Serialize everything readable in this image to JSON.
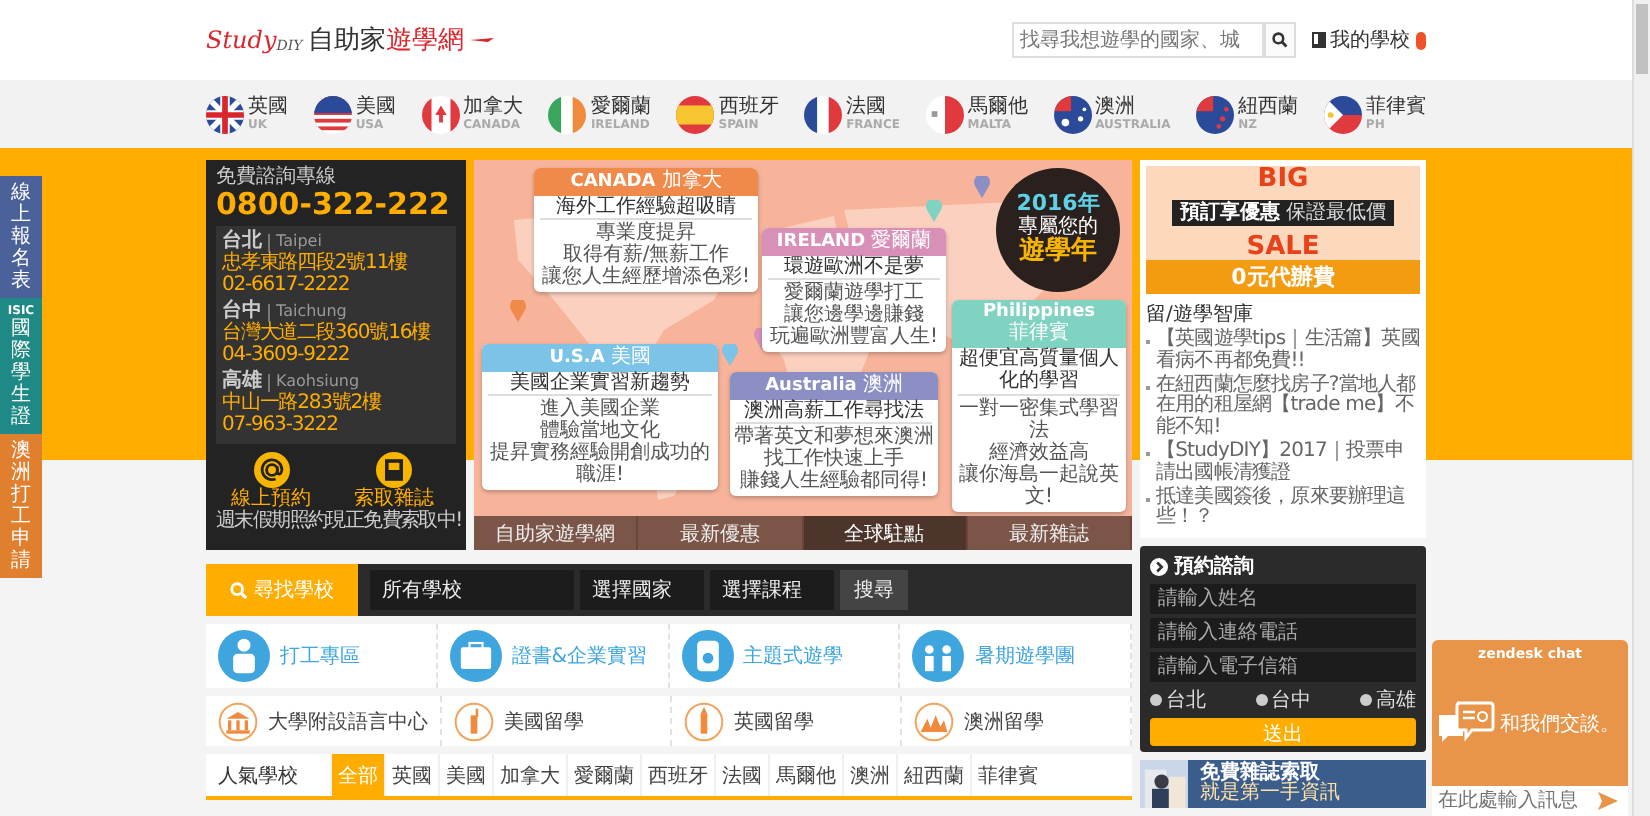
{
  "header": {
    "logo": {
      "latin": "Study",
      "latin_small": "DIY",
      "name": "自助家",
      "name_accent": "遊學網"
    },
    "search": {
      "placeholder": "找尋我想遊學的國家、城"
    },
    "my_school": "我的學校"
  },
  "countries": [
    {
      "name": "英國",
      "code": "UK",
      "kind": "uk"
    },
    {
      "name": "美國",
      "code": "USA",
      "kind": "usa"
    },
    {
      "name": "加拿大",
      "code": "CANADA",
      "kind": "canada"
    },
    {
      "name": "愛爾蘭",
      "code": "IRELAND",
      "kind": "ireland"
    },
    {
      "name": "西班牙",
      "code": "SPAIN",
      "kind": "spain"
    },
    {
      "name": "法國",
      "code": "FRANCE",
      "kind": "france"
    },
    {
      "name": "馬爾他",
      "code": "MALTA",
      "kind": "malta"
    },
    {
      "name": "澳洲",
      "code": "AUSTRALIA",
      "kind": "australia"
    },
    {
      "name": "紐西蘭",
      "code": "NZ",
      "kind": "nz"
    },
    {
      "name": "菲律賓",
      "code": "PH",
      "kind": "ph"
    }
  ],
  "side_tabs": [
    {
      "label": "線上報名表",
      "color": "#4a6199"
    },
    {
      "prefix": "ISIC",
      "label": "國際學生證",
      "color": "#1f8a85"
    },
    {
      "label": "澳洲打工申請",
      "color": "#e07f2e"
    }
  ],
  "contact": {
    "hotline_label": "免費諮詢專線",
    "hotline": "0800-322-222",
    "offices": [
      {
        "city": "台北",
        "city_en": "Taipei",
        "address": "忠孝東路四段2號11樓",
        "phone": "02-6617-2222"
      },
      {
        "city": "台中",
        "city_en": "Taichung",
        "address": "台灣大道二段360號16樓",
        "phone": "04-3609-9222"
      },
      {
        "city": "高雄",
        "city_en": "Kaohsiung",
        "address": "中山一路283號2樓",
        "phone": "07-963-3222"
      }
    ],
    "actions": [
      {
        "kind": "online",
        "label": "線上預約",
        "note": "週末假期照約"
      },
      {
        "kind": "magazine",
        "label": "索取雜誌",
        "note": "現正免費索取中!"
      }
    ]
  },
  "banner": {
    "badge": {
      "year": "2016年",
      "line": "專屬您的",
      "headline": "遊學年"
    },
    "callouts": [
      {
        "kind": "canada",
        "title": "CANADA",
        "title_local": "加拿大",
        "color": "#f08a4b",
        "headline": "海外工作經驗超吸睛",
        "lines": [
          "專業度提昇",
          "取得有薪/無薪工作",
          "讓您人生經歷增添色彩!"
        ]
      },
      {
        "kind": "ireland",
        "title": "IRELAND",
        "title_local": "愛爾蘭",
        "color": "#d88fb8",
        "headline": "環遊歐洲不是夢",
        "lines": [
          "愛爾蘭遊學打工",
          "讓您邊學邊賺錢",
          "玩遍歐洲豐富人生!"
        ]
      },
      {
        "kind": "usa",
        "title": "U.S.A",
        "title_local": "美國",
        "color": "#7cc3e8",
        "headline": "美國企業實習新趨勢",
        "lines": [
          "進入美國企業",
          "體驗當地文化",
          "提昇實務經驗開創成功的職涯!"
        ]
      },
      {
        "kind": "australia",
        "title": "Australia",
        "title_local": "澳洲",
        "color": "#8c8fc4",
        "headline": "澳洲高薪工作尋找法",
        "lines": [
          "帶著英文和夢想來澳洲",
          "找工作快速上手",
          "賺錢人生經驗都同得!"
        ]
      },
      {
        "kind": "philippines",
        "title": "Philippines",
        "title_local": "菲律賓",
        "color": "#7fd3c0",
        "headline": "超便宜高質量個人化的學習",
        "lines": [
          "一對一密集式學習法",
          "經濟效益高",
          "讓你海島一起說英文!"
        ]
      }
    ],
    "tabs": [
      {
        "label": "自助家遊學網",
        "selected": false
      },
      {
        "label": "最新優惠",
        "selected": false
      },
      {
        "label": "全球駐點",
        "selected": true
      },
      {
        "label": "最新雜誌",
        "selected": false
      }
    ]
  },
  "sidebar": {
    "promo": {
      "big": "BIG",
      "sale": "SALE",
      "ribbon": "預訂享優惠",
      "ribbon_sub": "保證最低價",
      "price": "0元代辦費"
    },
    "articles_title": "留/遊學智庫",
    "articles": [
      "【英國遊學tips｜生活篇】英國看病不再都免費!!",
      "在紐西蘭怎麼找房子?當地人都在用的租屋網【trade me】不能不知!",
      "【StudyDIY】2017｜投票申請出國帳清獲證",
      "抵達美國簽後，原來要辦理這些！？"
    ]
  },
  "school_search": {
    "label": "尋找學校",
    "selects": [
      "所有學校",
      "選擇國家",
      "選擇課程"
    ],
    "button": "搜尋"
  },
  "featured_categories": [
    {
      "label": "打工專區",
      "kind": "work"
    },
    {
      "label": "證書&企業實習",
      "kind": "case"
    },
    {
      "label": "主題式遊學",
      "kind": "theme"
    },
    {
      "label": "暑期遊學團",
      "kind": "group"
    }
  ],
  "study_categories": [
    {
      "label": "大學附設語言中心",
      "kind": "university"
    },
    {
      "label": "美國留學",
      "kind": "liberty"
    },
    {
      "label": "英國留學",
      "kind": "tower"
    },
    {
      "label": "澳洲留學",
      "kind": "opera"
    }
  ],
  "popular": {
    "label": "人氣學校",
    "tabs": [
      {
        "label": "全部",
        "selected": true
      },
      {
        "label": "英國",
        "selected": false
      },
      {
        "label": "美國",
        "selected": false
      },
      {
        "label": "加拿大",
        "selected": false
      },
      {
        "label": "愛爾蘭",
        "selected": false
      },
      {
        "label": "西班牙",
        "selected": false
      },
      {
        "label": "法國",
        "selected": false
      },
      {
        "label": "馬爾他",
        "selected": false
      },
      {
        "label": "澳洲",
        "selected": false
      },
      {
        "label": "紐西蘭",
        "selected": false
      },
      {
        "label": "菲律賓",
        "selected": false
      }
    ]
  },
  "booking": {
    "title": "預約諮詢",
    "fields": [
      {
        "placeholder": "請輸入姓名"
      },
      {
        "placeholder": "請輸入連絡電話"
      },
      {
        "placeholder": "請輸入電子信箱"
      }
    ],
    "offices": [
      {
        "label": "台北",
        "selected": false
      },
      {
        "label": "台中",
        "selected": false
      },
      {
        "label": "高雄",
        "selected": false
      }
    ],
    "submit": "送出"
  },
  "magazine": {
    "title": "免費雜誌索取",
    "lines": [
      "就是第一手資訊"
    ]
  },
  "chat": {
    "brand": "zendesk chat",
    "greeting": "和我們交談。",
    "placeholder": "在此處輸入訊息"
  }
}
